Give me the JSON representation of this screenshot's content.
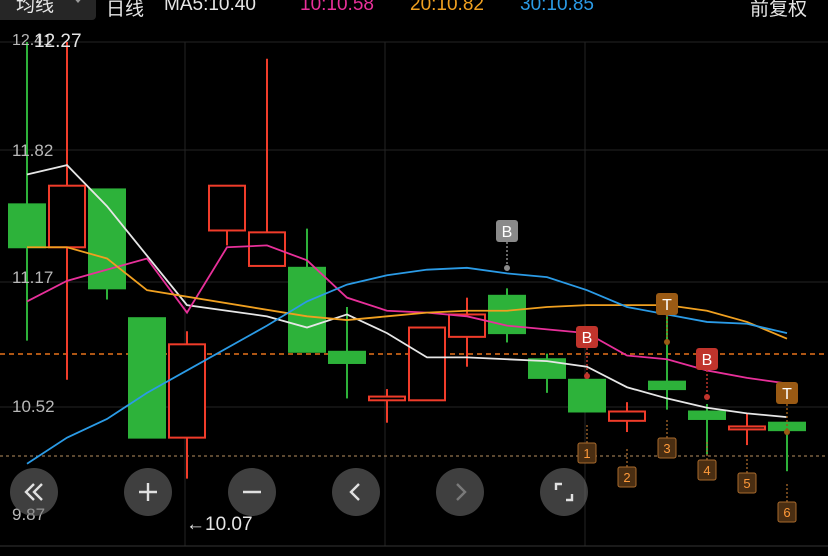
{
  "topbar": {
    "period_selector": "均线",
    "timeframe": "日线",
    "ma5": "MA5:10.40",
    "ma10": "10:10.58",
    "ma20": "20:10.82",
    "ma30": "30:10.85",
    "adjust": "前复权"
  },
  "colors": {
    "up": "#f03c2a",
    "down": "#2db23a",
    "ma5": "#e6e6e6",
    "ma10": "#e8309a",
    "ma20": "#f0a020",
    "ma30": "#2b9be6",
    "buy_marker": "#c0342c",
    "buy_marker_gray": "#8a8a8a",
    "t_marker": "#9a5a14",
    "dashed_line": "#e8731a"
  },
  "y_axis_labels": {
    "top": "12.41",
    "l2": "11.82",
    "l3": "11.17",
    "l4": "10.52",
    "bottom": "9.87"
  },
  "annotations": {
    "max_price": "12.27",
    "min_price": "←10.07"
  },
  "markers": {
    "b1": "B",
    "b2": "B",
    "b3": "B",
    "t1": "T",
    "t2": "T",
    "n1": "1",
    "n2": "2",
    "n3": "3",
    "n4": "4",
    "n5": "5",
    "n6": "6"
  },
  "controls": {
    "first": "double-left-icon",
    "zoom_in": "plus-icon",
    "zoom_out": "minus-icon",
    "prev": "chevron-left-icon",
    "next": "chevron-right-icon",
    "fit": "corners-icon"
  },
  "chart_data": {
    "type": "candlestick",
    "y_range": [
      9.87,
      12.41
    ],
    "candles": [
      {
        "o": 11.54,
        "h": 12.41,
        "l": 10.81,
        "c": 11.31
      },
      {
        "o": 11.31,
        "h": 12.41,
        "l": 10.6,
        "c": 11.64
      },
      {
        "o": 11.62,
        "h": 11.49,
        "l": 11.03,
        "c": 11.09
      },
      {
        "o": 10.93,
        "h": 10.93,
        "l": 10.29,
        "c": 10.29
      },
      {
        "o": 10.29,
        "h": 10.86,
        "l": 10.07,
        "c": 10.79
      },
      {
        "o": 11.4,
        "h": 11.64,
        "l": 11.32,
        "c": 11.64
      },
      {
        "o": 11.21,
        "h": 12.32,
        "l": 11.21,
        "c": 11.39
      },
      {
        "o": 11.2,
        "h": 11.41,
        "l": 10.75,
        "c": 10.75
      },
      {
        "o": 10.75,
        "h": 10.99,
        "l": 10.5,
        "c": 10.69
      },
      {
        "o": 10.49,
        "h": 10.55,
        "l": 10.37,
        "c": 10.51
      },
      {
        "o": 10.49,
        "h": 10.88,
        "l": 10.49,
        "c": 10.88
      },
      {
        "o": 10.83,
        "h": 11.04,
        "l": 10.67,
        "c": 10.95
      },
      {
        "o": 11.05,
        "h": 11.09,
        "l": 10.8,
        "c": 10.85
      },
      {
        "o": 10.71,
        "h": 10.74,
        "l": 10.53,
        "c": 10.61
      },
      {
        "o": 10.6,
        "h": 10.64,
        "l": 10.43,
        "c": 10.43
      },
      {
        "o": 10.38,
        "h": 10.48,
        "l": 10.32,
        "c": 10.43
      },
      {
        "o": 10.59,
        "h": 10.95,
        "l": 10.44,
        "c": 10.55
      },
      {
        "o": 10.43,
        "h": 10.47,
        "l": 10.2,
        "c": 10.39
      },
      {
        "o": 10.35,
        "h": 10.42,
        "l": 10.25,
        "c": 10.35
      },
      {
        "o": 10.37,
        "h": 10.37,
        "l": 10.11,
        "c": 10.33
      }
    ],
    "ma5": [
      11.7,
      11.75,
      11.53,
      null,
      11.0,
      10.97,
      10.94,
      10.88,
      10.95,
      10.85,
      10.72,
      10.72,
      10.71,
      10.7,
      10.67,
      10.56,
      10.5,
      10.45,
      10.42,
      10.4
    ],
    "ma10": [
      11.02,
      11.13,
      11.19,
      11.25,
      10.96,
      11.31,
      11.32,
      11.24,
      11.04,
      10.97,
      10.96,
      10.94,
      10.89,
      10.87,
      10.85,
      10.73,
      10.71,
      10.65,
      10.61,
      10.58
    ],
    "ma20": [
      11.31,
      11.31,
      11.25,
      11.08,
      null,
      null,
      null,
      10.94,
      10.92,
      10.94,
      10.96,
      10.97,
      10.97,
      10.99,
      11.0,
      11.0,
      11.0,
      10.97,
      10.91,
      10.82
    ],
    "ma30": [
      10.15,
      10.29,
      10.39,
      10.53,
      10.65,
      null,
      10.89,
      11.02,
      11.11,
      11.16,
      11.19,
      11.2,
      11.17,
      11.15,
      11.08,
      10.99,
      10.95,
      10.91,
      10.9,
      10.85
    ]
  }
}
